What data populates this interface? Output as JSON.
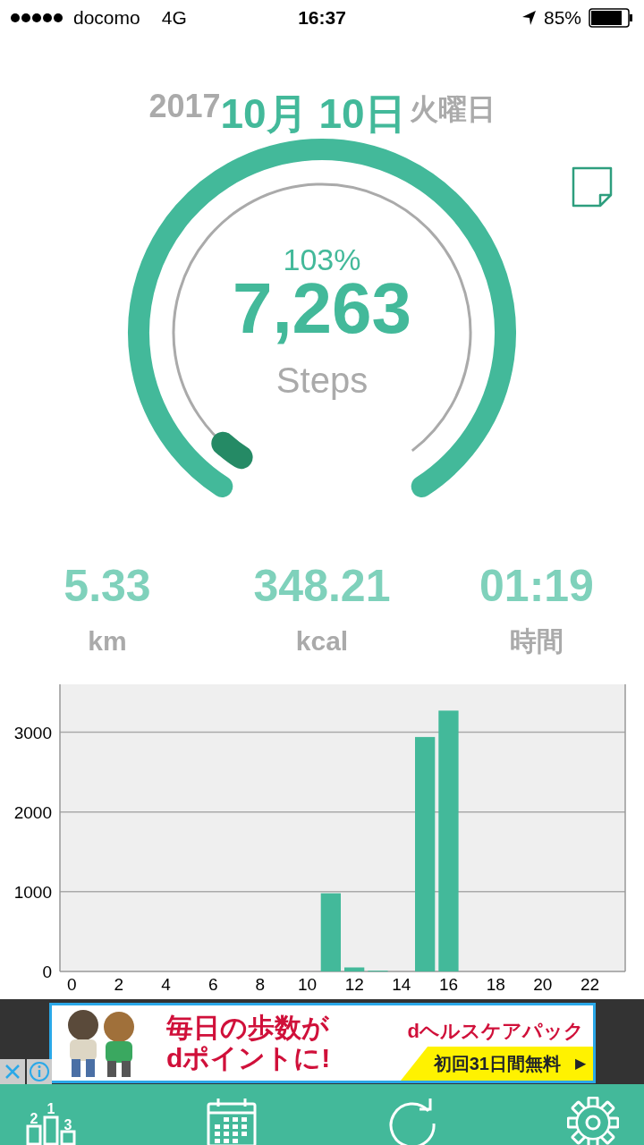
{
  "status_bar": {
    "carrier": "docomo",
    "network": "4G",
    "time": "16:37",
    "battery": "85%"
  },
  "date": {
    "year": "2017",
    "month_day": "10月 10日",
    "weekday": "火曜日"
  },
  "gauge": {
    "percent": "103%",
    "steps": "7,263",
    "unit": "Steps"
  },
  "stats": [
    {
      "value": "5.33",
      "label": "km"
    },
    {
      "value": "348.21",
      "label": "kcal"
    },
    {
      "value": "01:19",
      "label": "時間"
    }
  ],
  "chart": {
    "chart_data": {
      "type": "bar",
      "x": [
        0,
        1,
        2,
        3,
        4,
        5,
        6,
        7,
        8,
        9,
        10,
        11,
        12,
        13,
        14,
        15,
        16,
        17,
        18,
        19,
        20,
        21,
        22,
        23
      ],
      "series": [
        {
          "color": "#43b99a",
          "values": [
            0,
            0,
            0,
            0,
            0,
            0,
            0,
            0,
            0,
            0,
            0,
            980,
            50,
            10,
            0,
            2940,
            3270,
            0,
            0,
            0,
            0,
            0,
            0,
            0
          ]
        }
      ],
      "xticks": [
        0,
        2,
        4,
        6,
        8,
        10,
        12,
        14,
        16,
        18,
        20,
        22
      ],
      "yticks": [
        0,
        1000,
        2000,
        3000
      ],
      "xlim": [
        -0.5,
        23.5
      ],
      "ylim": [
        0,
        3600
      ],
      "grid": true
    }
  },
  "ad": {
    "headline": [
      "毎日の歩数が",
      "dポイントに!"
    ],
    "brand": "dヘルスケアパック",
    "offer": "初回31日間無料",
    "offer_arrow": "▶"
  },
  "tab_bar": {
    "podium_labels": [
      "1",
      "2",
      "3"
    ]
  }
}
